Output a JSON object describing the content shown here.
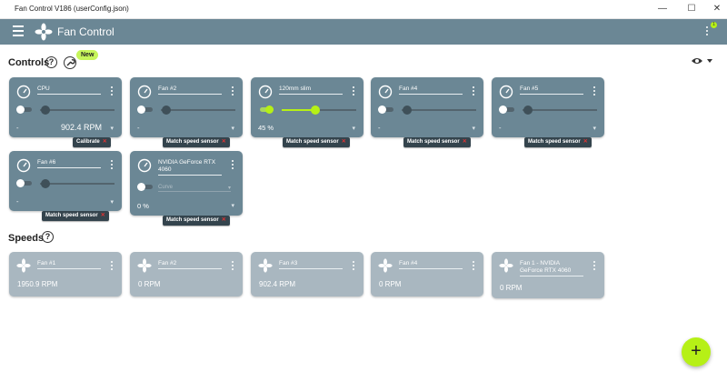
{
  "window": {
    "title": "Fan Control V186 (userConfig.json)",
    "min": "—",
    "max": "☐",
    "close": "✕"
  },
  "appbar": {
    "title": "Fan Control",
    "notification_count": "1"
  },
  "controls_section": {
    "title": "Controls",
    "help": "?",
    "new_badge": "New"
  },
  "controls": [
    {
      "name": "CPU",
      "value": "-",
      "rpm": "902.4 RPM",
      "tag": "Calibrate",
      "enabled": false,
      "level": 0
    },
    {
      "name": "Fan #2",
      "value": "-",
      "rpm": "",
      "tag": "Match speed sensor",
      "enabled": false,
      "level": 0
    },
    {
      "name": "120mm slim",
      "value": "45 %",
      "rpm": "",
      "tag": "Match speed sensor",
      "enabled": true,
      "level": 0.45
    },
    {
      "name": "Fan #4",
      "value": "-",
      "rpm": "",
      "tag": "Match speed sensor",
      "enabled": false,
      "level": 0
    },
    {
      "name": "Fan #5",
      "value": "-",
      "rpm": "",
      "tag": "Match speed sensor",
      "enabled": false,
      "level": 0
    },
    {
      "name": "Fan #6",
      "value": "-",
      "rpm": "",
      "tag": "Match speed sensor",
      "enabled": false,
      "level": 0
    },
    {
      "name": "NVIDIA GeForce RTX 4060",
      "value": "0 %",
      "rpm": "",
      "tag": "Match speed sensor",
      "enabled": false,
      "curve": "Curve"
    }
  ],
  "speeds_section": {
    "title": "Speeds",
    "help": "?"
  },
  "speeds": [
    {
      "name": "Fan #1",
      "value": "1950.9 RPM"
    },
    {
      "name": "Fan #2",
      "value": "0 RPM"
    },
    {
      "name": "Fan #3",
      "value": "902.4 RPM"
    },
    {
      "name": "Fan #4",
      "value": "0 RPM"
    },
    {
      "name": "Fan 1 - NVIDIA GeForce RTX 4060",
      "value": "0 RPM"
    }
  ],
  "fab": {
    "label": "+"
  },
  "colors": {
    "card": "#6b8795",
    "speed_card": "#a9b7c0",
    "accent": "#b6f016"
  }
}
